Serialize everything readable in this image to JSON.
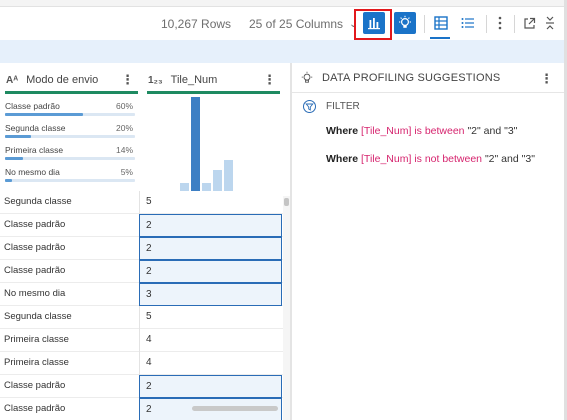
{
  "toolbar": {
    "rows": "10,267 Rows",
    "columns": "25 of 25 Columns",
    "buttons": [
      "column-profile",
      "suggestions",
      "grid-view",
      "list-view",
      "more-options",
      "pop-out",
      "collapse"
    ],
    "accent": "#1a73c8",
    "highlight": "#e2181c"
  },
  "columns": [
    {
      "type": "Aᴬ",
      "name": "Modo de envio",
      "menu": "⋮",
      "distribution": [
        {
          "label": "Classe padrão",
          "pct": "60%",
          "value": 0.6
        },
        {
          "label": "Segunda classe",
          "pct": "20%",
          "value": 0.2
        },
        {
          "label": "Primeira classe",
          "pct": "14%",
          "value": 0.14
        },
        {
          "label": "No mesmo dia",
          "pct": "5%",
          "value": 0.05
        }
      ]
    },
    {
      "type": "1₂₃",
      "name": "Tile_Num",
      "menu": "⋮",
      "histogram": [
        {
          "value": 0.09,
          "highlighted": false
        },
        {
          "value": 1.0,
          "highlighted": true
        },
        {
          "value": 0.09,
          "highlighted": false
        },
        {
          "value": 0.22,
          "highlighted": false
        },
        {
          "value": 0.33,
          "highlighted": false
        }
      ]
    }
  ],
  "rows": [
    {
      "mode": "Segunda classe",
      "tile": "5",
      "selected": false
    },
    {
      "mode": "Classe padrão",
      "tile": "2",
      "selected": true
    },
    {
      "mode": "Classe padrão",
      "tile": "2",
      "selected": true
    },
    {
      "mode": "Classe padrão",
      "tile": "2",
      "selected": true
    },
    {
      "mode": "No mesmo dia",
      "tile": "3",
      "selected": true
    },
    {
      "mode": "Segunda classe",
      "tile": "5",
      "selected": false
    },
    {
      "mode": "Primeira classe",
      "tile": "4",
      "selected": false
    },
    {
      "mode": "Primeira classe",
      "tile": "4",
      "selected": false
    },
    {
      "mode": "Classe padrão",
      "tile": "2",
      "selected": true
    },
    {
      "mode": "Classe padrão",
      "tile": "2",
      "selected": true
    }
  ],
  "suggestions": {
    "title": "DATA PROFILING SUGGESTIONS",
    "menu": "⋮",
    "filter_title": "FILTER",
    "rules": [
      {
        "kw": "Where",
        "col": "[Tile_Num]",
        "op": "is between",
        "v1": "\"2\"",
        "and": "and",
        "v2": "\"3\""
      },
      {
        "kw": "Where",
        "col": "[Tile_Num]",
        "op": "is not between",
        "v1": "\"2\"",
        "and": "and",
        "v2": "\"3\""
      }
    ]
  }
}
